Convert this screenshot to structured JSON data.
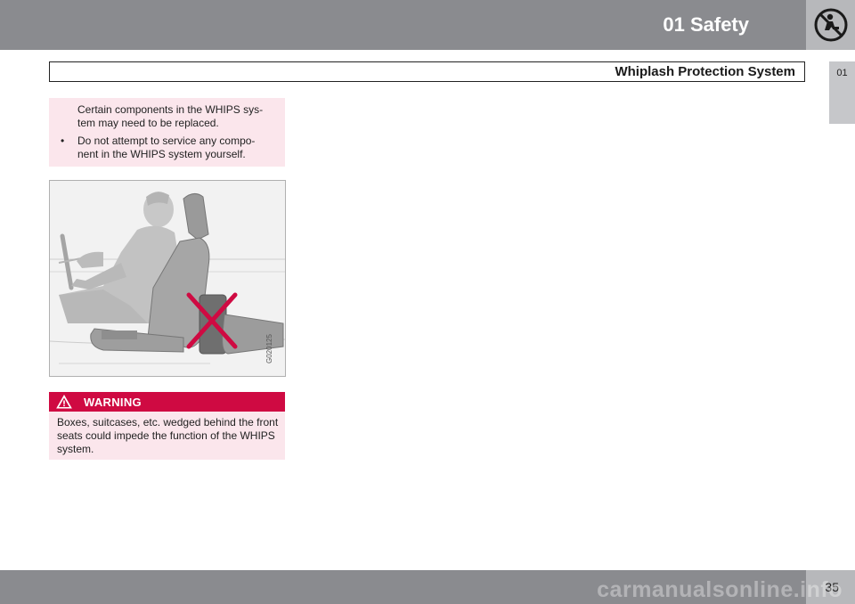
{
  "header": {
    "chapter_title": "01 Safety",
    "chapter_icon": "no-seatbelt-icon",
    "section_title": "Whiplash Protection System",
    "side_tab": "01"
  },
  "content": {
    "intro_line": "Certain components in the WHIPS sys-\ntem may need to be replaced.",
    "bullet_symbol": "•",
    "bullet_text": "Do not attempt to service any compo-\nnent in the WHIPS system yourself.",
    "figure": {
      "code": "G020125",
      "icon": "prohibited-cross-icon",
      "accent_color": "#cf0a42"
    },
    "warning": {
      "title": "WARNING",
      "text": "Boxes, suitcases, etc. wedged behind the front seats could impede the function of the WHIPS system.",
      "color": "#cf0a42"
    }
  },
  "footer": {
    "page_number": "35",
    "watermark": "carmanualsonline.info"
  }
}
